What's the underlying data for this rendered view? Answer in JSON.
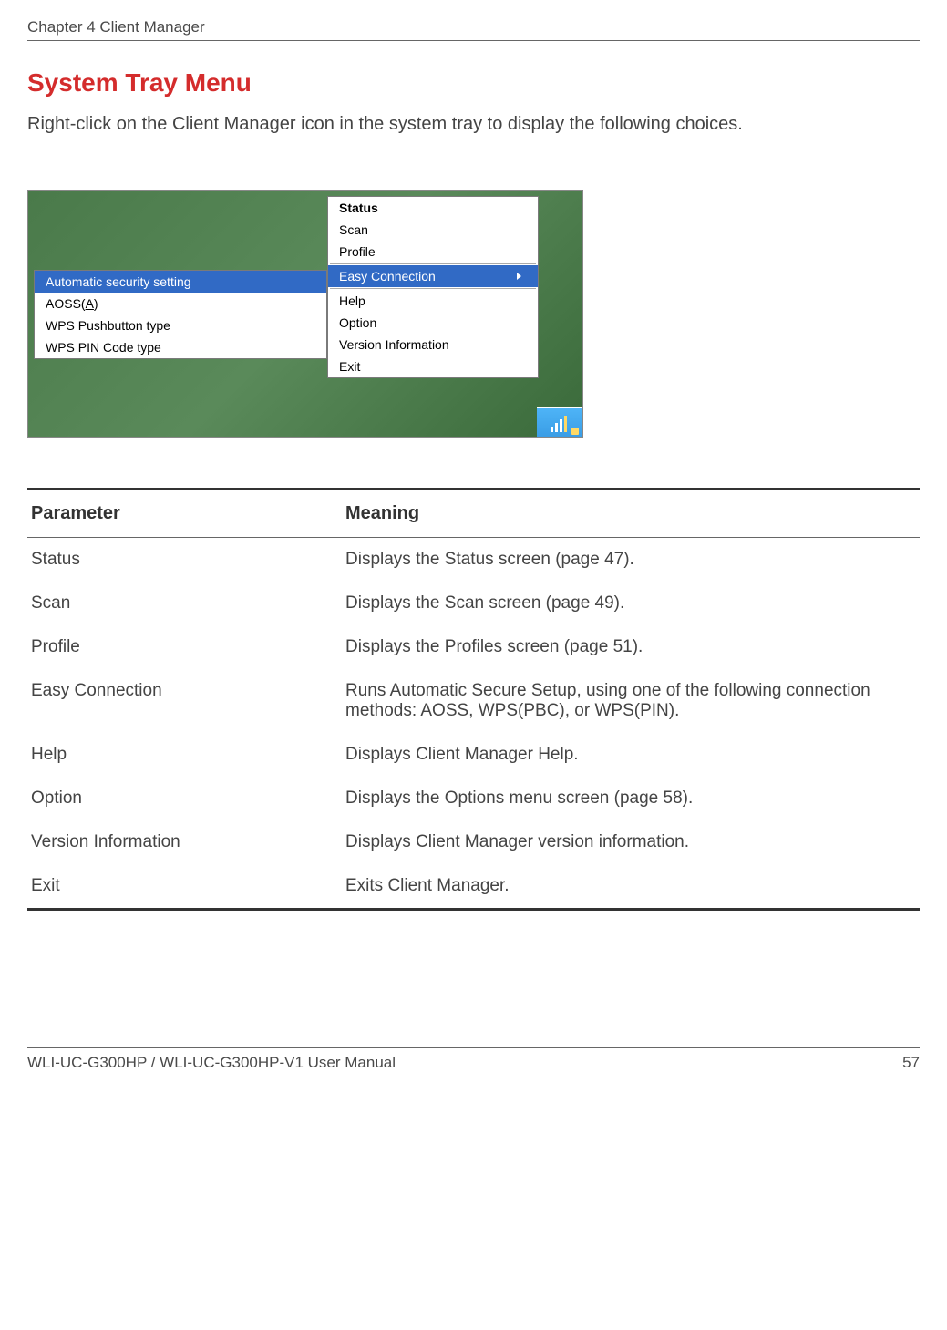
{
  "header": {
    "chapter": "Chapter 4  Client Manager"
  },
  "section": {
    "title": "System Tray Menu",
    "intro": "Right-click on the Client Manager icon in the system tray to display the following choices."
  },
  "menu": {
    "items": [
      {
        "label": "Status",
        "bold": true
      },
      {
        "label": "Scan"
      },
      {
        "label": "Profile"
      }
    ],
    "easy_connection": "Easy Connection",
    "items2": [
      {
        "label": "Help"
      },
      {
        "label": "Option"
      },
      {
        "label": "Version Information"
      },
      {
        "label": "Exit"
      }
    ]
  },
  "submenu": {
    "auto_security": "Automatic security setting",
    "aoss_prefix": "AOSS(",
    "aoss_key": "A",
    "aoss_suffix": ")",
    "wps_push": "WPS Pushbutton type",
    "wps_pin": "WPS PIN Code type"
  },
  "table": {
    "headers": {
      "parameter": "Parameter",
      "meaning": "Meaning"
    },
    "rows": [
      {
        "param": "Status",
        "meaning": "Displays the Status screen (page 47)."
      },
      {
        "param": "Scan",
        "meaning": "Displays the Scan screen (page 49)."
      },
      {
        "param": "Profile",
        "meaning": "Displays the Profiles screen (page 51)."
      },
      {
        "param": "Easy Connection",
        "meaning": "Runs Automatic Secure Setup, using one of the following connection methods:  AOSS, WPS(PBC), or WPS(PIN)."
      },
      {
        "param": "Help",
        "meaning": "Displays Client Manager Help."
      },
      {
        "param": "Option",
        "meaning": "Displays the Options menu screen (page 58)."
      },
      {
        "param": "Version Information",
        "meaning": "Displays Client Manager version information."
      },
      {
        "param": "Exit",
        "meaning": "Exits Client Manager."
      }
    ]
  },
  "footer": {
    "model": "WLI-UC-G300HP / WLI-UC-G300HP-V1 User Manual",
    "page": "57"
  }
}
